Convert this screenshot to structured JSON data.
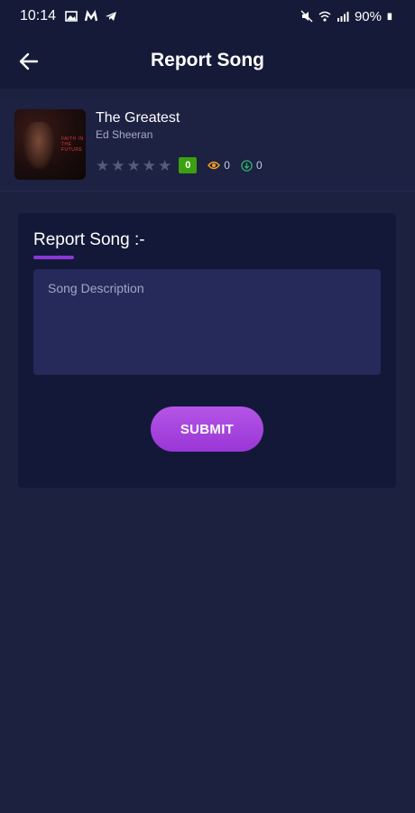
{
  "status_bar": {
    "time": "10:14",
    "battery": "90%",
    "left_icons": [
      "image-icon",
      "m-app-icon",
      "telegram-icon"
    ],
    "right_icons": [
      "mute-icon",
      "wifi-icon",
      "lte-signal-icon",
      "battery-icon"
    ]
  },
  "app_bar": {
    "title": "Report Song",
    "back_icon": "arrow-left-icon"
  },
  "song": {
    "title": "The Greatest",
    "artist": "Ed Sheeran",
    "album_art_text": "FAITH IN THE FUTURE",
    "rating_stars_filled": 0,
    "rating_stars_total": 5,
    "rating_badge": "0",
    "views": "0",
    "downloads": "0"
  },
  "report": {
    "heading": "Report Song :-",
    "description_placeholder": "Song Description",
    "description_value": "",
    "submit_label": "SUBMIT"
  },
  "colors": {
    "background": "#1c2140",
    "app_bar": "#151a38",
    "card": "#131838",
    "input": "#262a5a",
    "accent": "#9a36d6",
    "badge_green": "#3aa10f",
    "views_icon": "#f0a020",
    "downloads_icon": "#2fb36a"
  }
}
